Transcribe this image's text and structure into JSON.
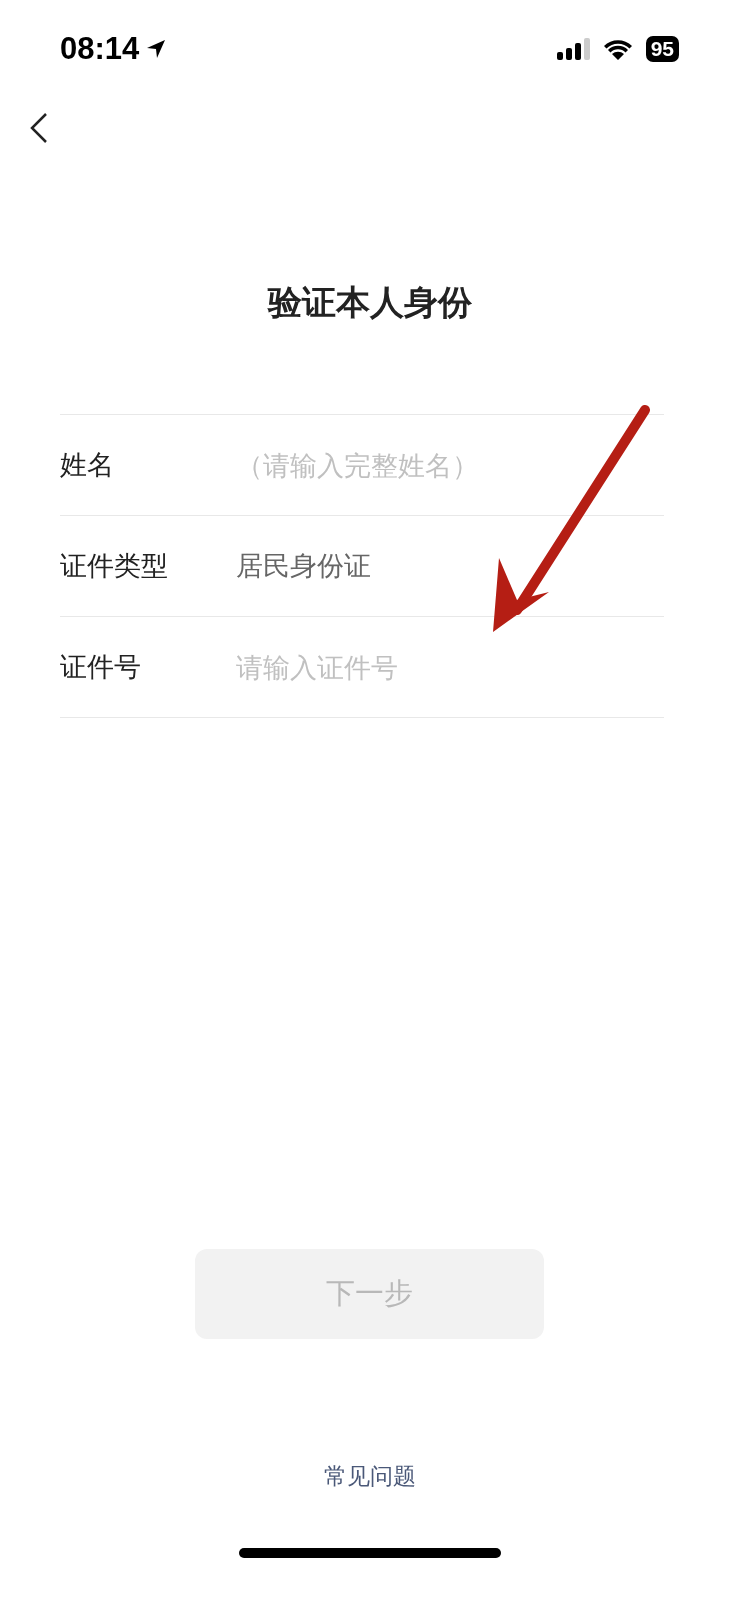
{
  "status_bar": {
    "time": "08:14",
    "battery": "95"
  },
  "title": "验证本人身份",
  "form": {
    "rows": [
      {
        "label": "姓名",
        "kind": "input",
        "placeholder": "（请输入完整姓名）"
      },
      {
        "label": "证件类型",
        "kind": "select",
        "value": "居民身份证"
      },
      {
        "label": "证件号",
        "kind": "input",
        "placeholder": "请输入证件号"
      }
    ]
  },
  "next_button": {
    "label": "下一步",
    "disabled": true
  },
  "faq_link": "常见问题"
}
